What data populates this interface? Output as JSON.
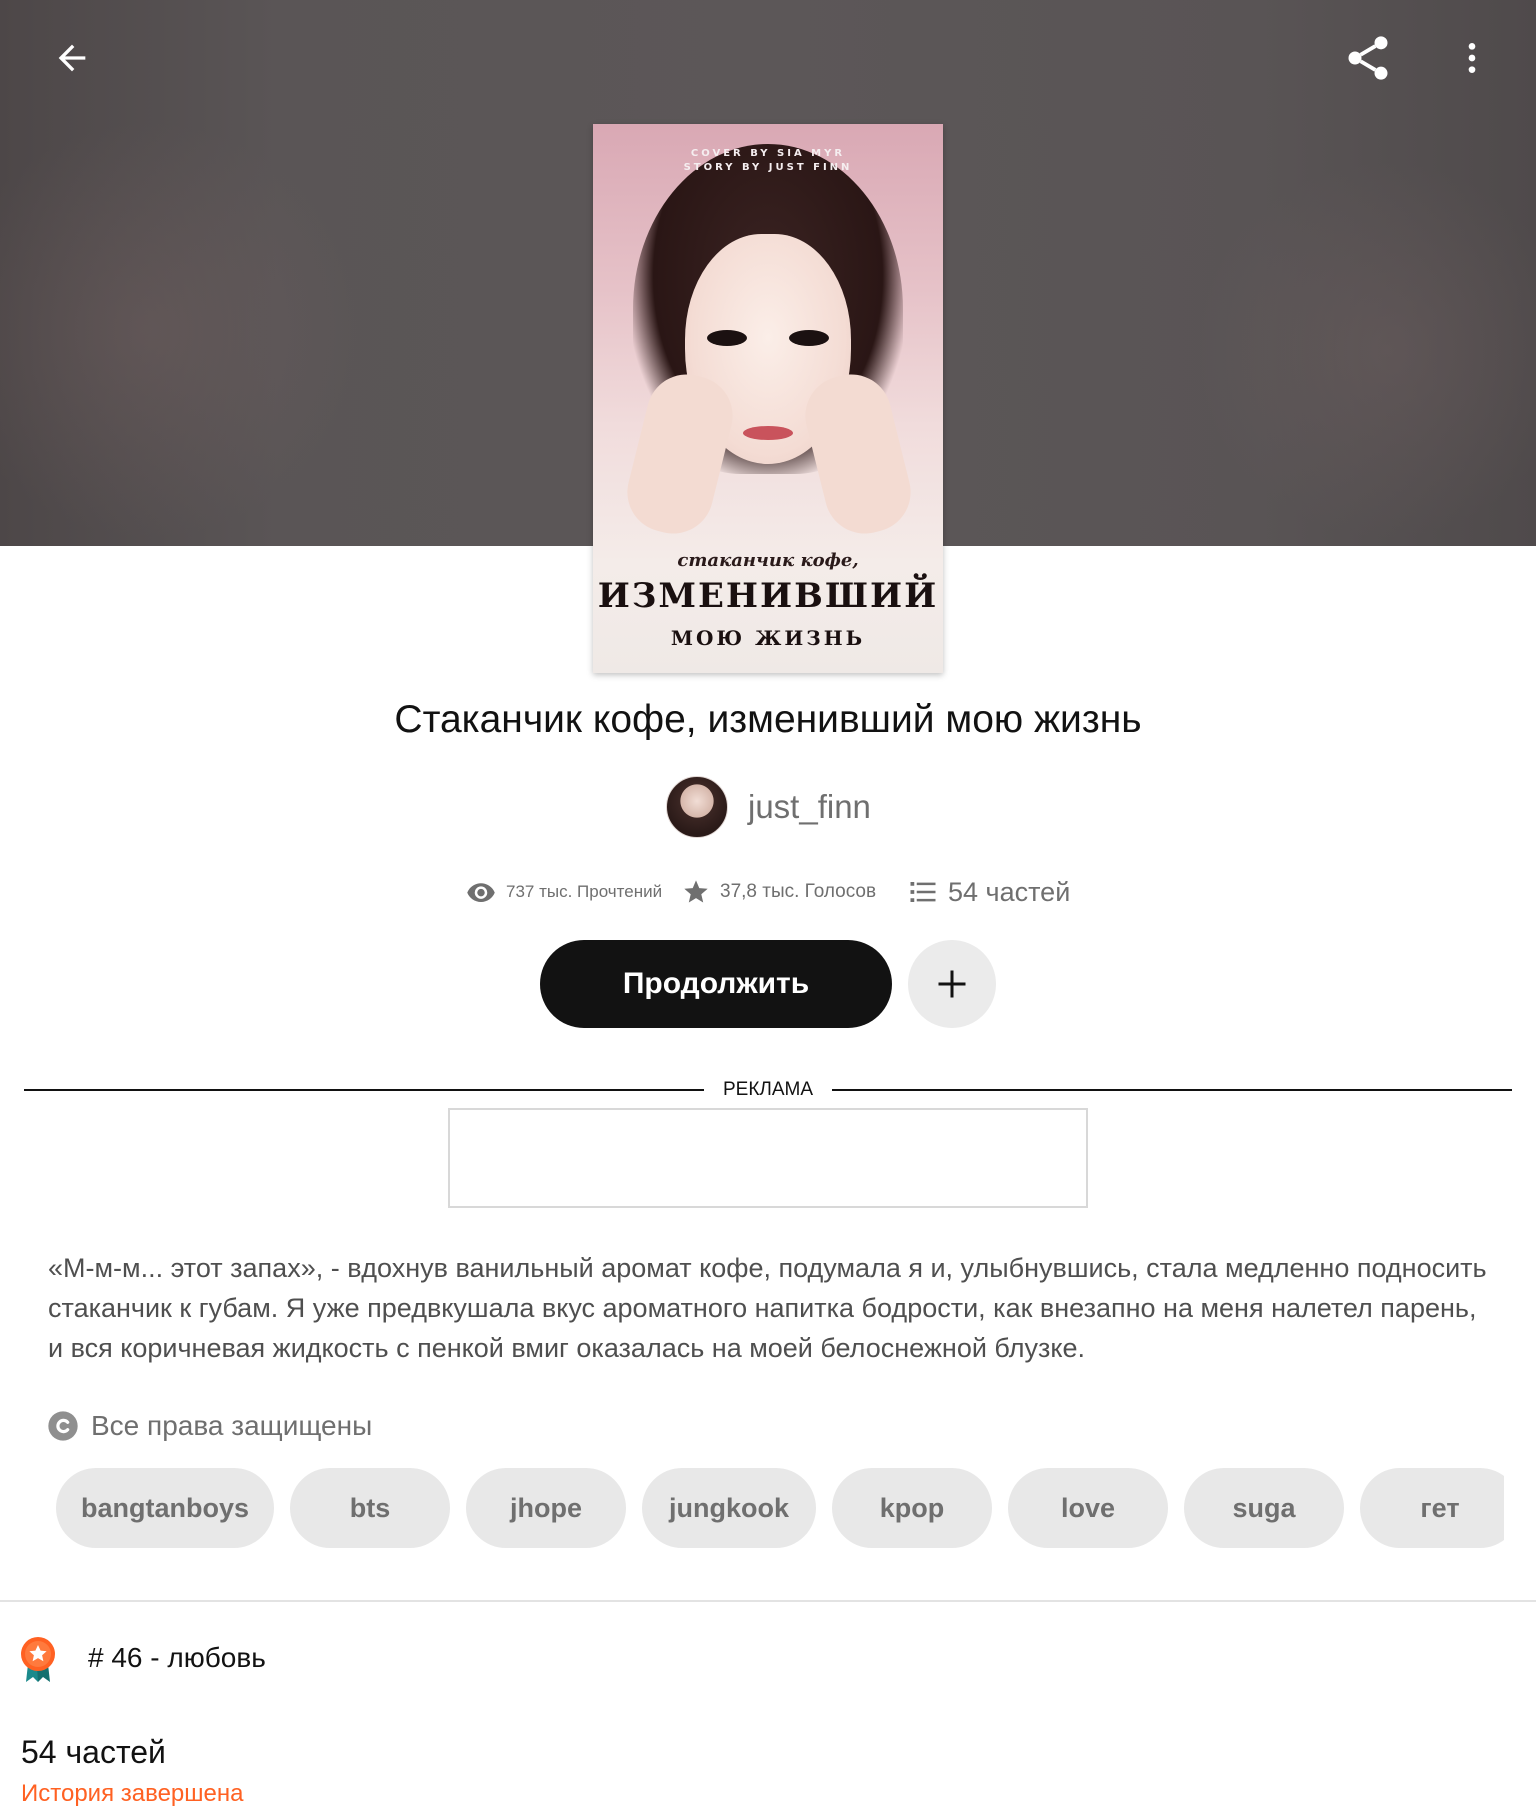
{
  "header": {
    "back_icon": "arrow-left-icon",
    "share_icon": "share-icon",
    "more_icon": "more-vertical-icon"
  },
  "cover": {
    "credit_line1": "COVER BY SIA MYR",
    "credit_line2": "STORY BY JUST FINN",
    "script_text": "стаканчик кофе,",
    "big_text": "ИЗМЕНИВШИЙ",
    "sub_text": "МОЮ ЖИЗНЬ"
  },
  "story": {
    "title": "Стаканчик кофе, изменивший мою жизнь",
    "author": "just_finn"
  },
  "stats": {
    "reads": "737 тыс. Прочтений",
    "votes": "37,8 тыс. Голосов",
    "parts": "54 частей"
  },
  "actions": {
    "continue_label": "Продолжить",
    "add_icon": "plus-icon"
  },
  "ad": {
    "label": "РЕКЛАМА"
  },
  "description": "«М-м-м... этот запах», - вдохнув ванильный аромат кофе, подумала я и, улыбнувшись, стала медленно подносить стаканчик к губам. Я уже предвкушала вкус ароматного напитка бодрости, как внезапно на меня налетел парень, и вся коричневая жидкость с пенкой вмиг оказалась на моей белоснежной блузке.",
  "copyright": "Все права защищены",
  "tags": [
    "bangtanboys",
    "bts",
    "jhope",
    "jungkook",
    "kpop",
    "love",
    "suga",
    "гет"
  ],
  "ranking": {
    "text": "# 46 - любовь",
    "icon": "award-badge-icon"
  },
  "footer": {
    "parts_count": "54 частей",
    "status": "История завершена"
  },
  "colors": {
    "accent_orange": "#ff6122",
    "button_dark": "#121212",
    "muted_text": "#6f6f6f"
  }
}
